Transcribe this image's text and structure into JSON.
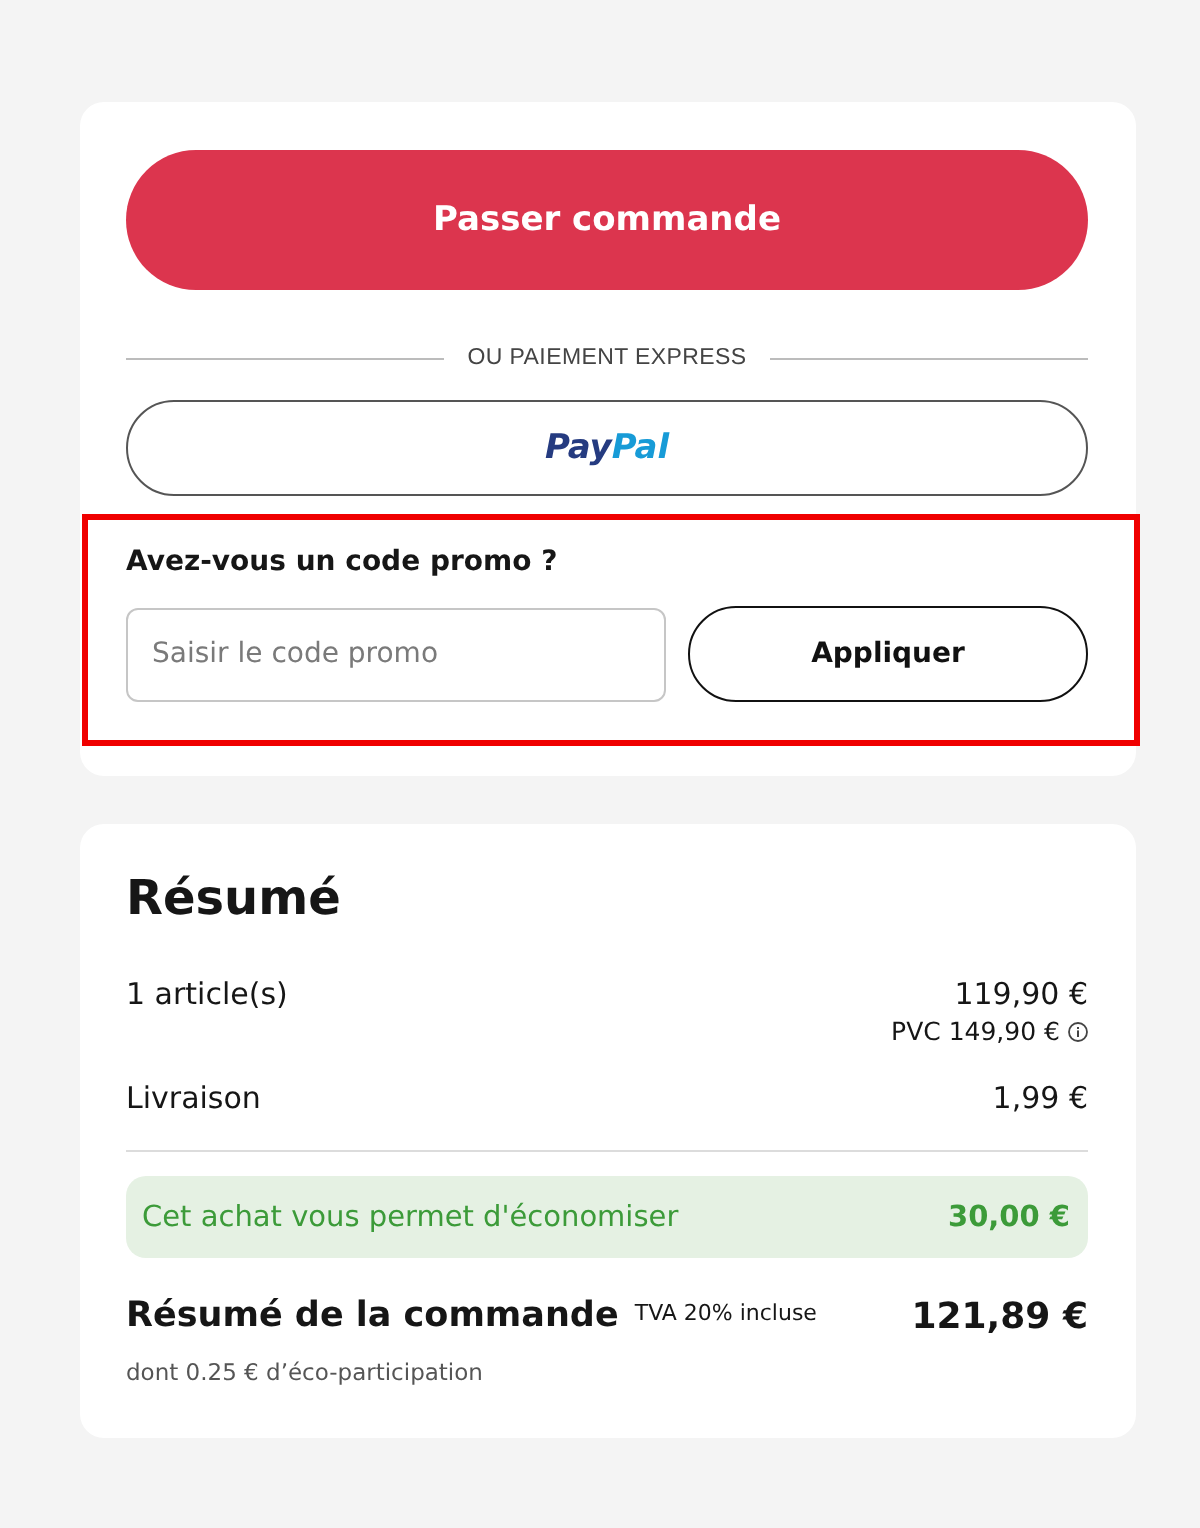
{
  "checkout": {
    "order_button": "Passer commande",
    "divider_label": "OU PAIEMENT EXPRESS",
    "paypal_button": {
      "logo_parts": [
        "Pay",
        "Pal"
      ]
    },
    "promo": {
      "highlighted": true,
      "title": "Avez-vous un code promo ?",
      "field": {
        "placeholder": "Saisir le code promo"
      },
      "apply_button": "Appliquer"
    }
  },
  "summary": {
    "title": "Résumé",
    "lines": [
      {
        "label": "1 article(s)",
        "amount": "119,90 €",
        "note": "PVC 149,90 €"
      },
      {
        "label": "Livraison",
        "amount": "1,99 €"
      }
    ],
    "savings": {
      "label": "Cet achat vous permet d'économiser",
      "amount": "30,00 €"
    },
    "total": {
      "label": "Résumé de la commande",
      "tax_note": "TVA 20% incluse",
      "amount": "121,89 €",
      "eco_note": "dont 0.25 € d’éco-participation"
    }
  }
}
